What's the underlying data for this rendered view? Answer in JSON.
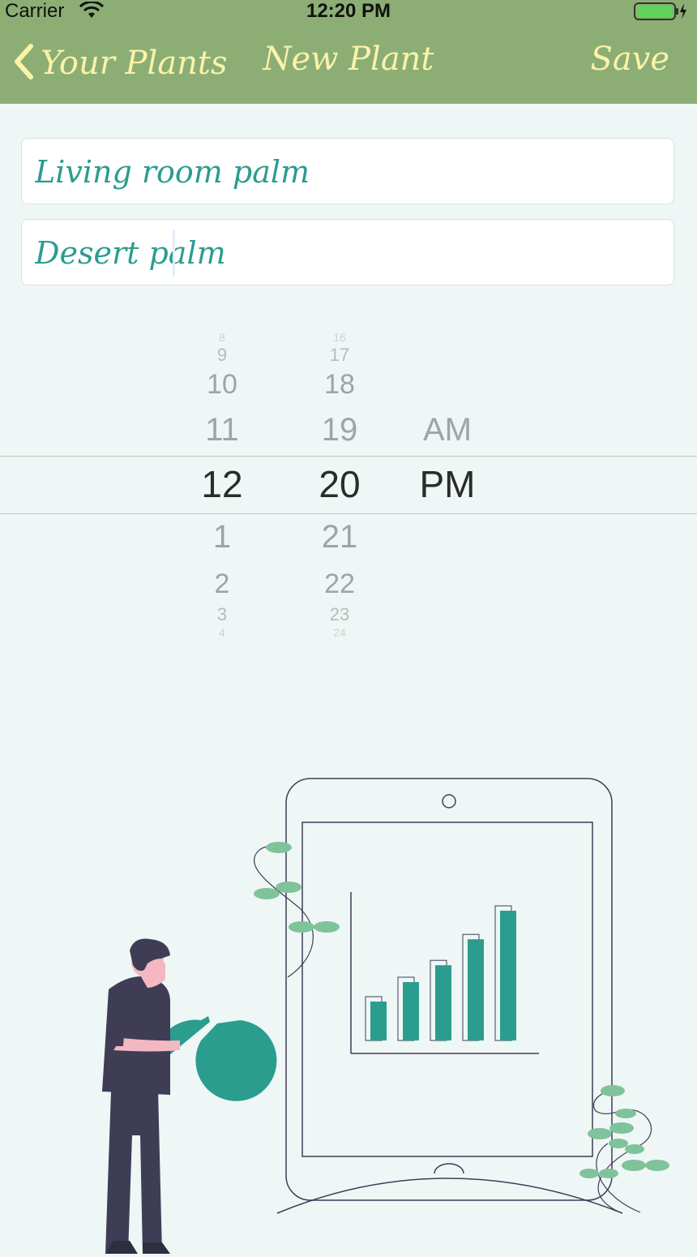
{
  "status_bar": {
    "carrier": "Carrier",
    "time": "12:20 PM"
  },
  "nav": {
    "back_label": "Your Plants",
    "title": "New Plant",
    "save_label": "Save"
  },
  "form": {
    "name_value": "Living room palm",
    "type_value": "Desert palm"
  },
  "time_picker": {
    "hours": [
      "8",
      "9",
      "10",
      "11",
      "12",
      "1",
      "2",
      "3",
      "4"
    ],
    "minutes": [
      "16",
      "17",
      "18",
      "19",
      "20",
      "21",
      "22",
      "23",
      "24"
    ],
    "periods": [
      "AM",
      "PM"
    ],
    "selected": {
      "hour": "12",
      "minute": "20",
      "period": "PM"
    }
  },
  "colors": {
    "nav_bg": "#8cae75",
    "nav_text": "#faf3a8",
    "accent": "#2a9d8f",
    "leaf": "#7fc39a",
    "person": "#3f3d56",
    "background": "#eef7f5"
  },
  "illustration": {
    "bars": [
      {
        "value": 0.3
      },
      {
        "value": 0.45
      },
      {
        "value": 0.58
      },
      {
        "value": 0.78
      },
      {
        "value": 1.0
      }
    ]
  }
}
